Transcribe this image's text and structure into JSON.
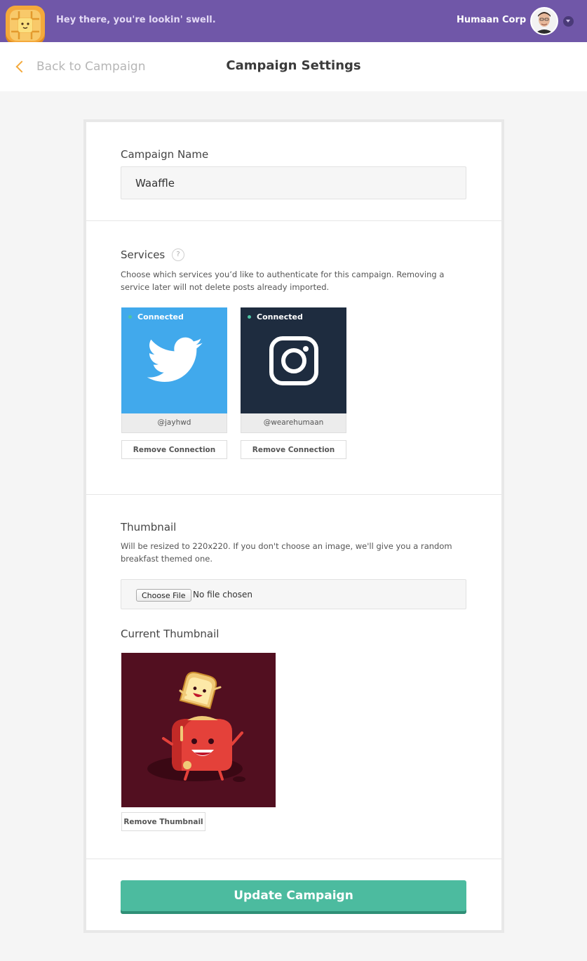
{
  "header": {
    "greeting": "Hey there, you're lookin' swell.",
    "org_name": "Humaan Corp",
    "brand_color": "#7057a8"
  },
  "subheader": {
    "back_label": "Back to Campaign",
    "title": "Campaign Settings"
  },
  "campaign_name": {
    "label": "Campaign Name",
    "value": "Waaffle"
  },
  "services": {
    "label": "Services",
    "help_icon": "?",
    "description": "Choose which services you’d like to authenticate for this campaign. Removing a service later will not delete posts already imported.",
    "items": [
      {
        "name": "twitter",
        "icon": "twitter-icon",
        "status": "Connected",
        "handle": "@jayhwd",
        "remove_label": "Remove Connection",
        "color": "#41a9ec"
      },
      {
        "name": "instagram",
        "icon": "instagram-icon",
        "status": "Connected",
        "handle": "@wearehumaan",
        "remove_label": "Remove Connection",
        "color": "#1e2c3f"
      }
    ]
  },
  "thumbnail": {
    "label": "Thumbnail",
    "description": "Will be resized to 220x220. If you don't choose an image, we'll give you a random breakfast themed one.",
    "choose_label": "Choose File",
    "file_status": "No file chosen",
    "current_label": "Current Thumbnail",
    "remove_label": "Remove Thumbnail"
  },
  "submit_label": "Update Campaign",
  "accent_color": "#4cbb9f"
}
